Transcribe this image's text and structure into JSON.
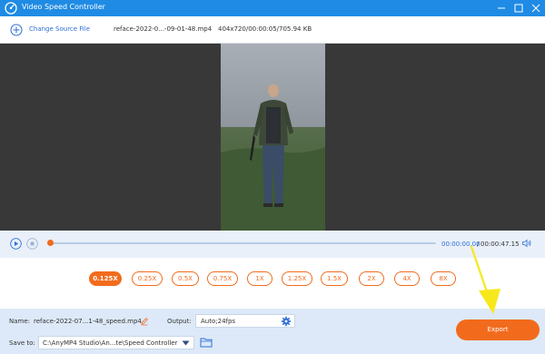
{
  "window": {
    "title": "Video Speed Controller",
    "accent": "#1f8be4"
  },
  "source": {
    "change_label": "Change Source File",
    "file_name": "reface-2022-0...-09-01-48.mp4",
    "file_info": "404x720/00:00:05/705.94 KB"
  },
  "playback": {
    "current_time": "00:00:00.00",
    "separator": "/",
    "total_time": "00:00:47.15",
    "progress": 0
  },
  "speeds": {
    "options": [
      "0.125X",
      "0.25X",
      "0.5X",
      "0.75X",
      "1X",
      "1.25X",
      "1.5X",
      "2X",
      "4X",
      "8X"
    ],
    "selected": "0.125X",
    "accent": "#f26b1d"
  },
  "output_panel": {
    "name_label": "Name:",
    "name_value": "reface-2022-07...1-48_speed.mp4",
    "output_label": "Output:",
    "output_value": "Auto;24fps",
    "save_label": "Save to:",
    "save_value": "C:\\AnyMP4 Studio\\An...te\\Speed Controller",
    "export_label": "Export"
  },
  "icons": {
    "app": "video-speed-logo-icon",
    "minimize": "minimize-icon",
    "maximize": "maximize-icon",
    "close": "close-icon",
    "add": "add-circle-icon",
    "play": "play-icon",
    "stop": "stop-icon",
    "volume": "volume-icon",
    "edit": "pencil-icon",
    "settings": "gear-icon",
    "dropdown": "chevron-down-icon",
    "folder": "folder-icon"
  }
}
